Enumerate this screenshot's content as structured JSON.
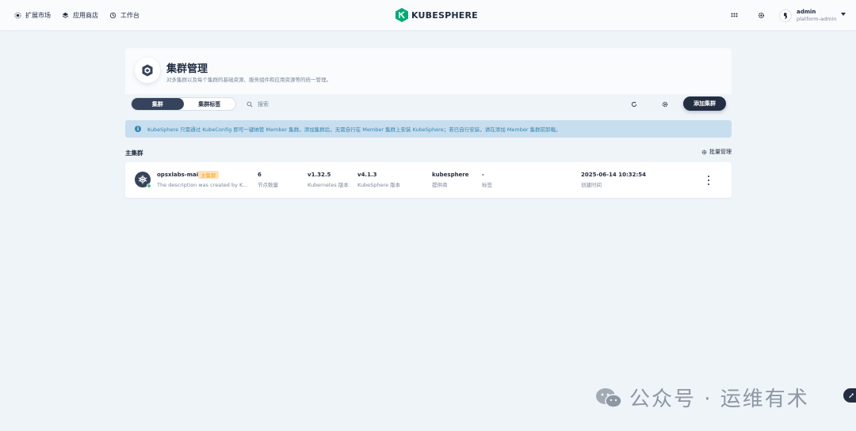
{
  "nav": {
    "items": [
      {
        "label": "扩展市场",
        "icon": "extension-icon"
      },
      {
        "label": "应用商店",
        "icon": "app-store-icon"
      },
      {
        "label": "工作台",
        "icon": "workbench-icon"
      }
    ],
    "logo_text": "KUBESPHERE",
    "user": {
      "name": "admin",
      "role": "platform-admin"
    }
  },
  "header": {
    "title": "集群管理",
    "description": "对多集群以及每个集群的基础资源、服务组件和应用资源等的统一管理。"
  },
  "toolbar": {
    "tabs": [
      {
        "label": "集群",
        "active": true
      },
      {
        "label": "集群标签",
        "active": false
      }
    ],
    "search_placeholder": "搜索",
    "add_label": "添加集群"
  },
  "banner": {
    "text": "KubeSphere 只需通过 KubeConfig 即可一键纳管 Member 集群。添加集群后，无需自行在 Member 集群上安装 KubeSphere；若已自行安装，请在添加 Member 集群前卸载。"
  },
  "section": {
    "title": "主集群",
    "batch_label": "批量管理"
  },
  "cluster": {
    "name": "opsxlabs-main",
    "badge": "主集群",
    "description": "The description was created by KubeSphere.",
    "columns": [
      {
        "value": "6",
        "label": "节点数量"
      },
      {
        "value": "v1.32.5",
        "label": "Kubernetes 版本"
      },
      {
        "value": "v4.1.3",
        "label": "KubeSphere 版本"
      },
      {
        "value": "kubesphere",
        "label": "提供商"
      },
      {
        "value": "-",
        "label": "标签"
      },
      {
        "value": "2025-06-14 10:32:54",
        "label": "创建时间"
      }
    ]
  },
  "watermark": {
    "text": "公众号 · 运维有术"
  },
  "colors": {
    "primary": "#242e42",
    "accent": "#00aa72",
    "info": "#3385b0",
    "badge_bg": "#ffe1be",
    "badge_fg": "#f5a623",
    "status_ok": "#55bc8a"
  }
}
